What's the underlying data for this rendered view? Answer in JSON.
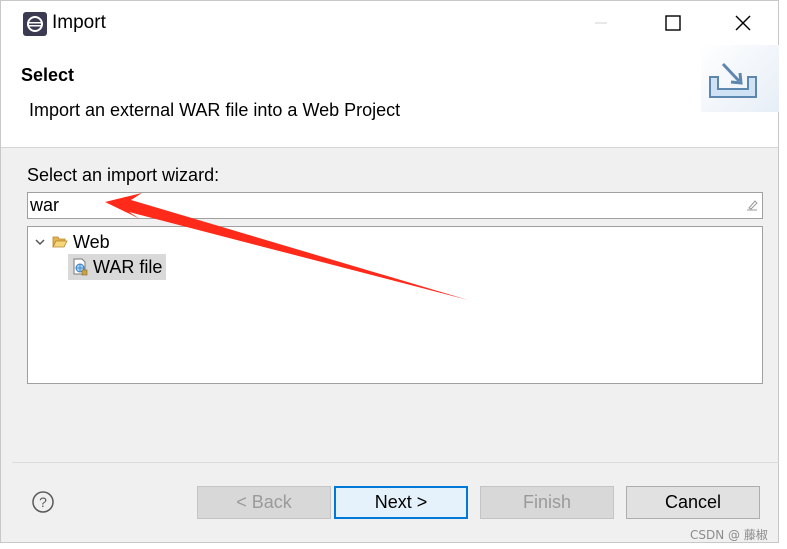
{
  "window": {
    "title": "Import",
    "icons": {
      "app": "eclipse-icon",
      "minimize": "minimize-icon",
      "maximize": "maximize-icon",
      "close": "close-icon"
    }
  },
  "banner": {
    "title": "Select",
    "description": "Import an external WAR file into a Web Project",
    "icon": "import-wizard-icon"
  },
  "wizard": {
    "label": "Select an import wizard:",
    "filter_value": "war",
    "tree": [
      {
        "label": "Web",
        "expanded": true,
        "icon": "folder-open-icon",
        "children": [
          {
            "label": "WAR file",
            "selected": true,
            "icon": "war-file-icon"
          }
        ]
      }
    ]
  },
  "buttons": {
    "back": "< Back",
    "next": "Next >",
    "finish": "Finish",
    "cancel": "Cancel"
  },
  "annotation": {
    "color": "#ff2a1a"
  },
  "watermark": "CSDN @ 藤椒"
}
